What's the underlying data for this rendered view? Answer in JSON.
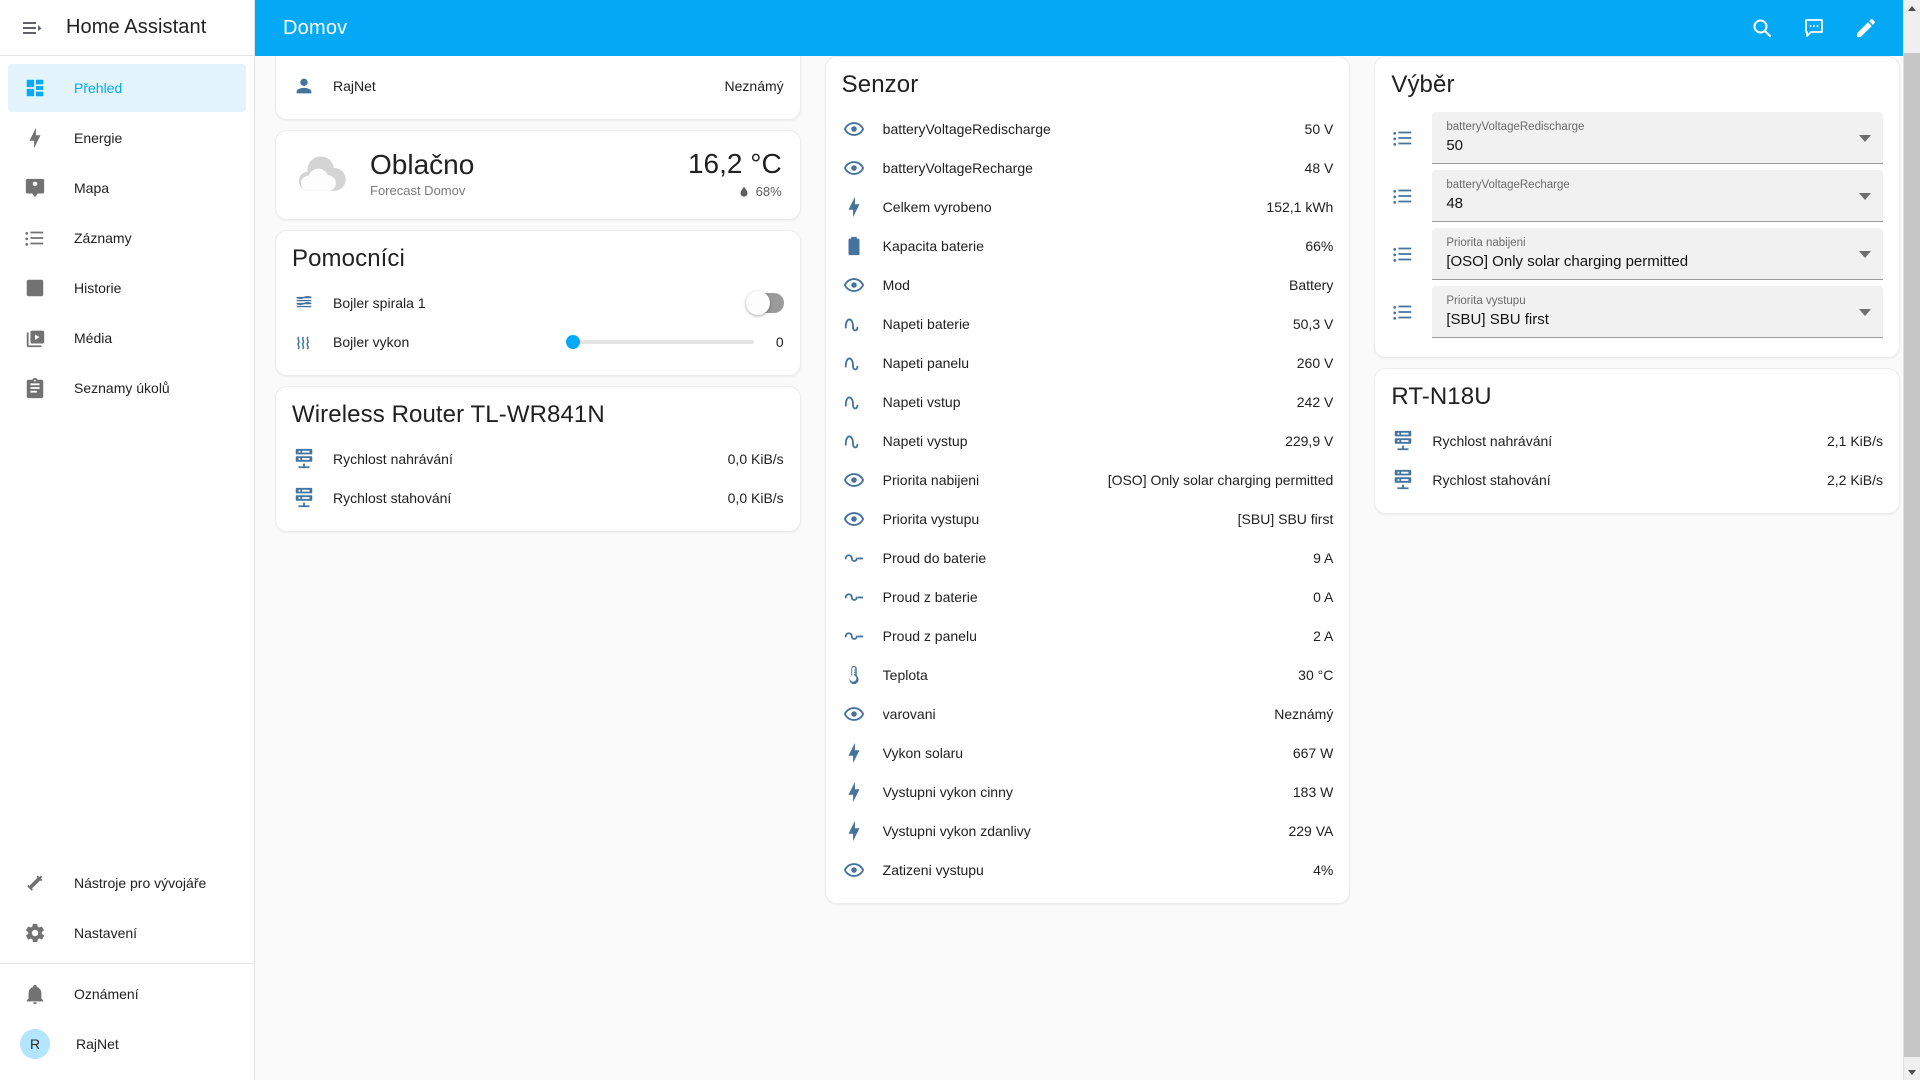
{
  "sidebar": {
    "title": "Home Assistant",
    "menu_icon": "menu-collapse-icon",
    "items": [
      {
        "label": "Přehled",
        "icon": "view-dashboard-icon",
        "active": true
      },
      {
        "label": "Energie",
        "icon": "lightning-bolt-icon",
        "active": false
      },
      {
        "label": "Mapa",
        "icon": "account-badge-icon",
        "active": false
      },
      {
        "label": "Záznamy",
        "icon": "format-list-bulleted-icon",
        "active": false
      },
      {
        "label": "Historie",
        "icon": "chart-box-icon",
        "active": false
      },
      {
        "label": "Média",
        "icon": "play-box-multiple-icon",
        "active": false
      },
      {
        "label": "Seznamy úkolů",
        "icon": "clipboard-list-icon",
        "active": false
      }
    ],
    "bottom_items": [
      {
        "label": "Nástroje pro vývojáře",
        "icon": "hammer-icon"
      },
      {
        "label": "Nastavení",
        "icon": "gear-icon"
      }
    ],
    "footer_items": [
      {
        "label": "Oznámení",
        "icon": "bell-icon"
      }
    ],
    "user": {
      "label": "RajNet",
      "initial": "R"
    }
  },
  "appbar": {
    "title": "Domov",
    "accent": "#03a9f4",
    "actions": [
      {
        "name": "search-icon",
        "label": "Hledat"
      },
      {
        "name": "assist-icon",
        "label": "Asistent"
      },
      {
        "name": "pencil-icon",
        "label": "Upravit"
      }
    ]
  },
  "columns": {
    "left": {
      "person_card": {
        "rows": [
          {
            "icon": "account-icon",
            "name": "RajNet",
            "value": "Neznámý"
          }
        ]
      },
      "weather_card": {
        "icon": "cloudy-icon",
        "condition": "Oblačno",
        "subtitle": "Forecast Domov",
        "temperature": "16,2 °C",
        "humidity": "68%",
        "humidity_icon": "water-percent-icon"
      },
      "helpers_card": {
        "title": "Pomocníci",
        "rows": [
          {
            "icon": "heating-coil-icon",
            "name": "Bojler spirala 1",
            "control": "toggle",
            "state": "off"
          },
          {
            "icon": "heat-wave-icon",
            "name": "Bojler vykon",
            "control": "slider",
            "value": "0",
            "percent": 0
          }
        ]
      },
      "router_card": {
        "title": "Wireless Router TL-WR841N",
        "rows": [
          {
            "icon": "server-network-upload-icon",
            "name": "Rychlost nahrávání",
            "value": "0,0 KiB/s"
          },
          {
            "icon": "server-network-download-icon",
            "name": "Rychlost stahování",
            "value": "0,0 KiB/s"
          }
        ]
      }
    },
    "middle": {
      "sensor_card": {
        "title": "Senzor",
        "rows": [
          {
            "icon": "eye-icon",
            "name": "batteryVoltageRedischarge",
            "value": "50 V"
          },
          {
            "icon": "eye-icon",
            "name": "batteryVoltageRecharge",
            "value": "48 V"
          },
          {
            "icon": "lightning-bolt-icon",
            "name": "Celkem vyrobeno",
            "value": "152,1 kWh"
          },
          {
            "icon": "battery-icon",
            "name": "Kapacita baterie",
            "value": "66%"
          },
          {
            "icon": "eye-icon",
            "name": "Mod",
            "value": "Battery"
          },
          {
            "icon": "sine-wave-icon",
            "name": "Napeti baterie",
            "value": "50,3 V"
          },
          {
            "icon": "sine-wave-icon",
            "name": "Napeti panelu",
            "value": "260 V"
          },
          {
            "icon": "sine-wave-icon",
            "name": "Napeti vstup",
            "value": "242 V"
          },
          {
            "icon": "sine-wave-icon",
            "name": "Napeti vystup",
            "value": "229,9 V"
          },
          {
            "icon": "eye-icon",
            "name": "Priorita nabijeni",
            "value": "[OSO] Only solar charging permitted"
          },
          {
            "icon": "eye-icon",
            "name": "Priorita vystupu",
            "value": "[SBU] SBU first"
          },
          {
            "icon": "current-dc-icon",
            "name": "Proud do baterie",
            "value": "9 A"
          },
          {
            "icon": "current-dc-icon",
            "name": "Proud z baterie",
            "value": "0 A"
          },
          {
            "icon": "current-dc-icon",
            "name": "Proud z panelu",
            "value": "2 A"
          },
          {
            "icon": "thermometer-icon",
            "name": "Teplota",
            "value": "30 °C"
          },
          {
            "icon": "eye-icon",
            "name": "varovani",
            "value": "Neznámý"
          },
          {
            "icon": "lightning-bolt-icon",
            "name": "Vykon solaru",
            "value": "667 W"
          },
          {
            "icon": "lightning-bolt-icon",
            "name": "Vystupni vykon cinny",
            "value": "183 W"
          },
          {
            "icon": "lightning-bolt-icon",
            "name": "Vystupni vykon zdanlivy",
            "value": "229 VA"
          },
          {
            "icon": "eye-icon",
            "name": "Zatizeni vystupu",
            "value": "4%"
          }
        ]
      }
    },
    "right": {
      "select_card": {
        "title": "Výběr",
        "selects": [
          {
            "icon": "format-list-bulleted-icon",
            "label": "batteryVoltageRedischarge",
            "value": "50"
          },
          {
            "icon": "format-list-bulleted-icon",
            "label": "batteryVoltageRecharge",
            "value": "48"
          },
          {
            "icon": "format-list-bulleted-icon",
            "label": "Priorita nabijeni",
            "value": "[OSO] Only solar charging permitted"
          },
          {
            "icon": "format-list-bulleted-icon",
            "label": "Priorita vystupu",
            "value": "[SBU] SBU first"
          }
        ]
      },
      "router_card": {
        "title": "RT-N18U",
        "rows": [
          {
            "icon": "server-network-upload-icon",
            "name": "Rychlost nahrávání",
            "value": "2,1 KiB/s"
          },
          {
            "icon": "server-network-download-icon",
            "name": "Rychlost stahování",
            "value": "2,2 KiB/s"
          }
        ]
      }
    }
  }
}
